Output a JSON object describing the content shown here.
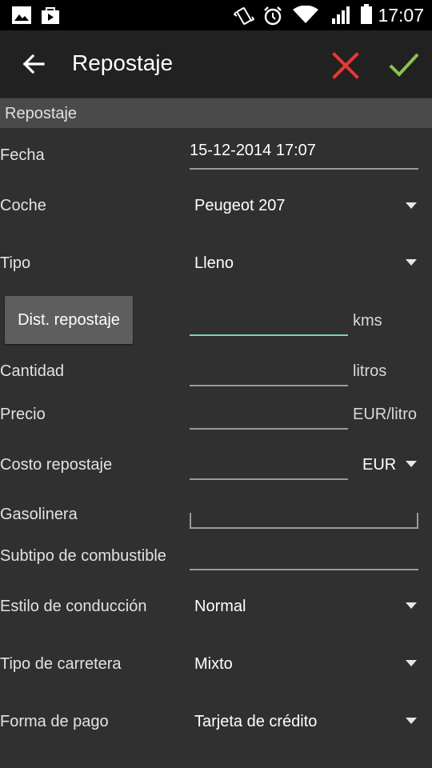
{
  "status_bar": {
    "time": "17:07",
    "icons": [
      "image-icon",
      "bag-icon",
      "vibrate-icon",
      "alarm-icon",
      "wifi-icon",
      "signal-icon",
      "battery-icon"
    ]
  },
  "appbar": {
    "title": "Repostaje",
    "back_icon": "arrow-left-icon",
    "cancel_icon": "close-icon",
    "confirm_icon": "check-icon",
    "cancel_color": "#e53935",
    "confirm_color": "#8bc34a"
  },
  "section": {
    "title": "Repostaje"
  },
  "form": {
    "fecha": {
      "label": "Fecha",
      "value": "15-12-2014 17:07"
    },
    "coche": {
      "label": "Coche",
      "value": "Peugeot 207"
    },
    "tipo": {
      "label": "Tipo",
      "value": "Lleno"
    },
    "distancia": {
      "button_label": "Dist. repostaje",
      "value": "",
      "unit": "kms"
    },
    "cantidad": {
      "label": "Cantidad",
      "value": "",
      "unit": "litros"
    },
    "precio": {
      "label": "Precio",
      "value": "",
      "unit": "EUR/litro"
    },
    "costo": {
      "label": "Costo repostaje",
      "value": "",
      "currency": "EUR"
    },
    "gasolinera": {
      "label": "Gasolinera",
      "value": ""
    },
    "subtipo": {
      "label": "Subtipo de combustible",
      "value": ""
    },
    "estilo": {
      "label": "Estilo de conducción",
      "value": "Normal"
    },
    "carretera": {
      "label": "Tipo de carretera",
      "value": "Mixto"
    },
    "pago": {
      "label": "Forma de pago",
      "value": "Tarjeta de crédito"
    }
  },
  "colors": {
    "background": "#303030",
    "appbar": "#212121",
    "focus_line": "#7fcfc6"
  }
}
